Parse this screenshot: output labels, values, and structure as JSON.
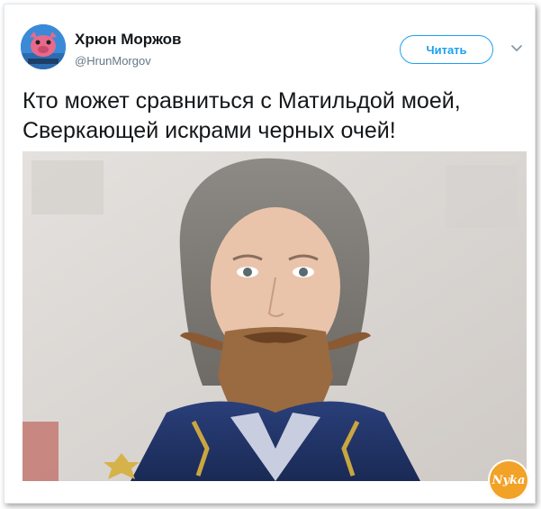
{
  "tweet": {
    "author_name": "Хрюн Моржов",
    "author_handle": "@HrunMorgov",
    "follow_label": "Читать",
    "text": "Кто может сравниться с Матильдой моей,\nСверкающей искрами черных очей!"
  },
  "icons": {
    "menu": "chevron-down-icon",
    "watermark": "site-logo"
  },
  "watermark": {
    "label": "Nyka"
  },
  "colors": {
    "accent": "#1da1f2",
    "text": "#14171a",
    "muted": "#657786"
  }
}
